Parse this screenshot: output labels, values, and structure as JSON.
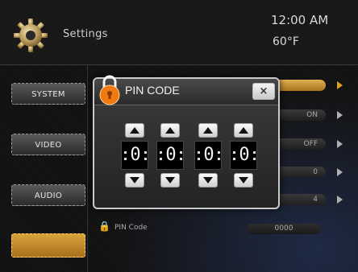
{
  "header": {
    "title": "Settings",
    "time": "12:00 AM",
    "temperature": "60°F"
  },
  "sidebar": {
    "items": [
      {
        "label": "SYSTEM"
      },
      {
        "label": "VIDEO"
      },
      {
        "label": "AUDIO"
      },
      {
        "label": "",
        "active": true
      }
    ]
  },
  "panel": {
    "rows": [
      {
        "value": ""
      },
      {
        "value": "ON"
      },
      {
        "value": "OFF"
      },
      {
        "value": "0"
      },
      {
        "value": "4"
      }
    ],
    "pin_row": {
      "label": "PIN Code",
      "value": "0000"
    }
  },
  "popup": {
    "title": "PIN CODE",
    "close_label": "×",
    "digits": [
      "0",
      "0",
      "0",
      "0"
    ]
  },
  "colors": {
    "accent": "#d9a23a",
    "lock_icon": "#f07a10",
    "background": "#101010"
  }
}
